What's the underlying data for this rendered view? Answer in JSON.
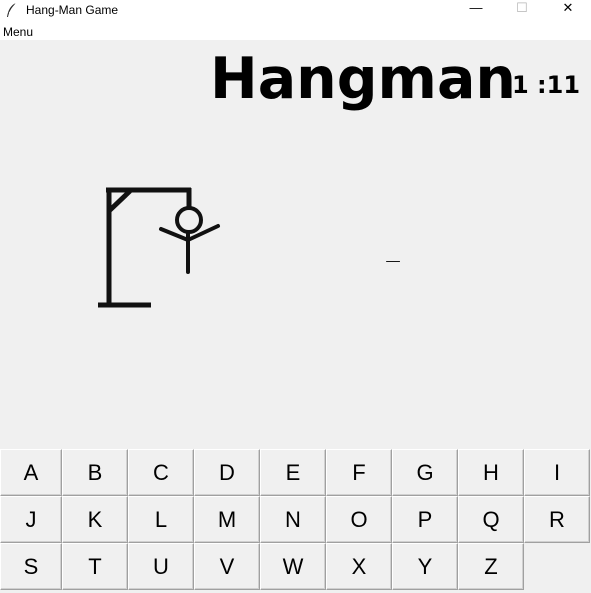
{
  "window": {
    "title": "Hang-Man Game",
    "icon": "feather-icon",
    "controls": {
      "minimize": "—",
      "maximize": "☐",
      "close": "✕"
    }
  },
  "menubar": {
    "menu_label": "Menu"
  },
  "game": {
    "title": "Hangman",
    "timer": "1 :11",
    "word_display": "_"
  },
  "keyboard": {
    "letters": [
      "A",
      "B",
      "C",
      "D",
      "E",
      "F",
      "G",
      "H",
      "I",
      "J",
      "K",
      "L",
      "M",
      "N",
      "O",
      "P",
      "Q",
      "R",
      "S",
      "T",
      "U",
      "V",
      "W",
      "X",
      "Y",
      "Z"
    ]
  }
}
